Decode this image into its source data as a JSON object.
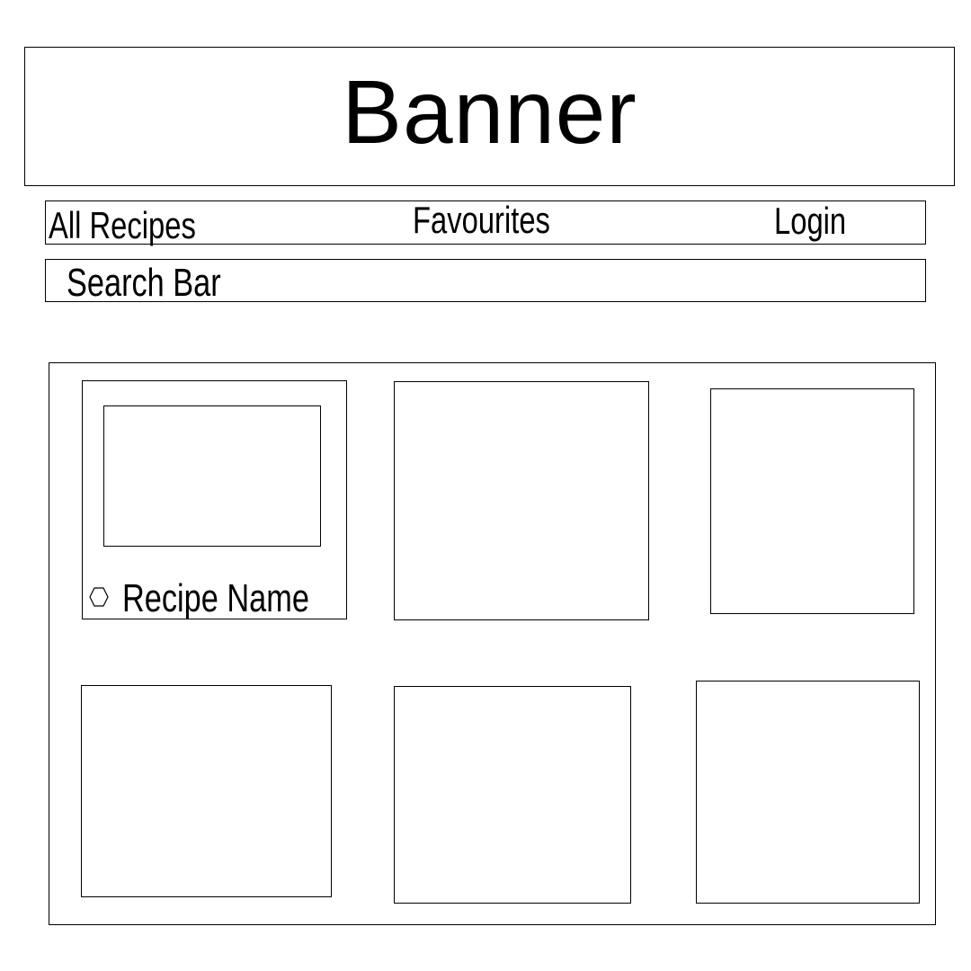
{
  "banner": {
    "title": "Banner"
  },
  "nav": {
    "items": [
      {
        "label": "All Recipes"
      },
      {
        "label": "Favourites"
      },
      {
        "label": "Login"
      }
    ]
  },
  "search": {
    "label": "Search Bar"
  },
  "recipes": {
    "cards": [
      {
        "name": "Recipe Name",
        "icon": "hexagon-icon"
      },
      {
        "name": ""
      },
      {
        "name": ""
      },
      {
        "name": ""
      },
      {
        "name": ""
      },
      {
        "name": ""
      }
    ]
  },
  "colors": {
    "stroke": "#000000",
    "background": "#ffffff"
  }
}
